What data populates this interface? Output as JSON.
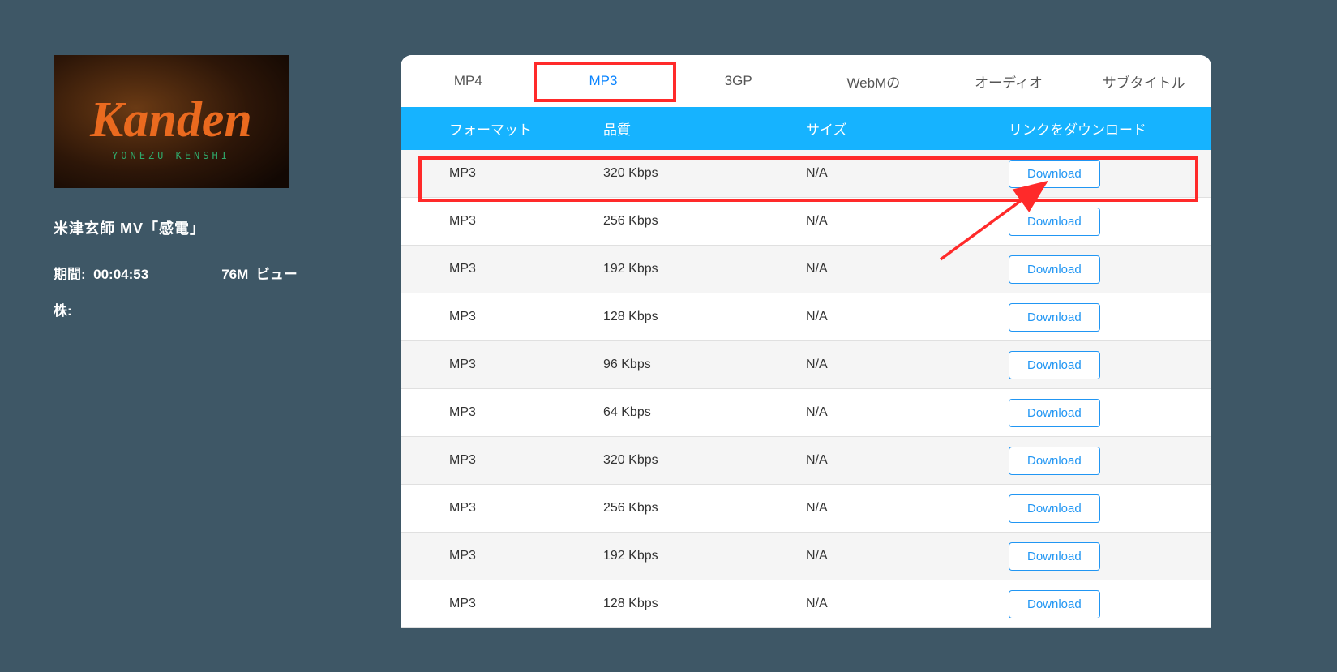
{
  "sidebar": {
    "title": "米津玄師 MV「感電」",
    "duration_label": "期間:",
    "duration_value": "00:04:53",
    "views_value": "76M",
    "views_label": "ビュー",
    "stock_label": "株:",
    "thumb_logo_main": "Kanden",
    "thumb_logo_sub": "YONEZU KENSHI"
  },
  "tabs": [
    "MP4",
    "MP3",
    "3GP",
    "WebMの",
    "オーディオ",
    "サブタイトル"
  ],
  "active_tab_index": 1,
  "table": {
    "headers": {
      "format": "フォーマット",
      "quality": "品質",
      "size": "サイズ",
      "link": "リンクをダウンロード"
    },
    "rows": [
      {
        "format": "MP3",
        "quality": "320 Kbps",
        "size": "N/A",
        "button": "Download"
      },
      {
        "format": "MP3",
        "quality": "256 Kbps",
        "size": "N/A",
        "button": "Download"
      },
      {
        "format": "MP3",
        "quality": "192 Kbps",
        "size": "N/A",
        "button": "Download"
      },
      {
        "format": "MP3",
        "quality": "128 Kbps",
        "size": "N/A",
        "button": "Download"
      },
      {
        "format": "MP3",
        "quality": "96 Kbps",
        "size": "N/A",
        "button": "Download"
      },
      {
        "format": "MP3",
        "quality": "64 Kbps",
        "size": "N/A",
        "button": "Download"
      },
      {
        "format": "MP3",
        "quality": "320 Kbps",
        "size": "N/A",
        "button": "Download"
      },
      {
        "format": "MP3",
        "quality": "256 Kbps",
        "size": "N/A",
        "button": "Download"
      },
      {
        "format": "MP3",
        "quality": "192 Kbps",
        "size": "N/A",
        "button": "Download"
      },
      {
        "format": "MP3",
        "quality": "128 Kbps",
        "size": "N/A",
        "button": "Download"
      }
    ]
  },
  "annotations": {
    "highlighted_row_index": 0
  },
  "colors": {
    "page_bg": "#3e5766",
    "accent_blue": "#16b3ff",
    "link_blue": "#2196f3",
    "highlight_red": "#ff2a2a"
  }
}
